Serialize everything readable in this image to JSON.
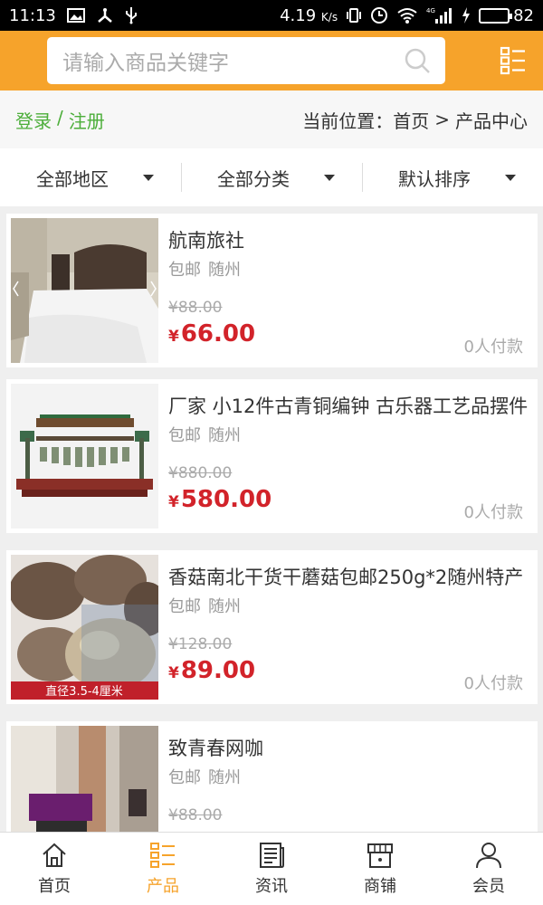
{
  "status_bar": {
    "time": "11:13",
    "speed": "4.19",
    "speed_unit": "K/s",
    "network": "4G",
    "battery": "82",
    "battery_level": 0.82
  },
  "search": {
    "placeholder": "请输入商品关键字"
  },
  "account": {
    "login": "登录",
    "separator": "/",
    "register": "注册"
  },
  "breadcrumb": {
    "prefix": "当前位置：",
    "home": "首页",
    "arrow": ">",
    "current": "产品中心"
  },
  "filters": [
    {
      "label": "全部地区"
    },
    {
      "label": "全部分类"
    },
    {
      "label": "默认排序"
    }
  ],
  "products": [
    {
      "title": "航南旅社",
      "shipping": "包邮",
      "city": "随州",
      "currency": "¥",
      "old_price": "¥88.00",
      "price": "66.00",
      "paid": "0人付款"
    },
    {
      "title": "厂家 小12件古青铜编钟 古乐器工艺品摆件",
      "shipping": "包邮",
      "city": "随州",
      "currency": "¥",
      "old_price": "¥880.00",
      "price": "580.00",
      "paid": "0人付款"
    },
    {
      "title": "香菇南北干货干蘑菇包邮250g*2随州特产",
      "shipping": "包邮",
      "city": "随州",
      "currency": "¥",
      "old_price": "¥128.00",
      "price": "89.00",
      "paid": "0人付款",
      "image_caption": "直径3.5-4厘米"
    },
    {
      "title": "致青春网咖",
      "shipping": "包邮",
      "city": "随州",
      "currency": "¥",
      "old_price": "¥88.00",
      "price": "",
      "paid": ""
    }
  ],
  "nav": {
    "items": [
      {
        "label": "首页",
        "icon": "home-icon"
      },
      {
        "label": "产品",
        "icon": "list-icon",
        "active": true
      },
      {
        "label": "资讯",
        "icon": "news-icon"
      },
      {
        "label": "商铺",
        "icon": "store-icon"
      },
      {
        "label": "会员",
        "icon": "user-icon"
      }
    ]
  },
  "colors": {
    "accent": "#f6a32b",
    "price": "#d2232a",
    "link": "#4cae3a"
  }
}
